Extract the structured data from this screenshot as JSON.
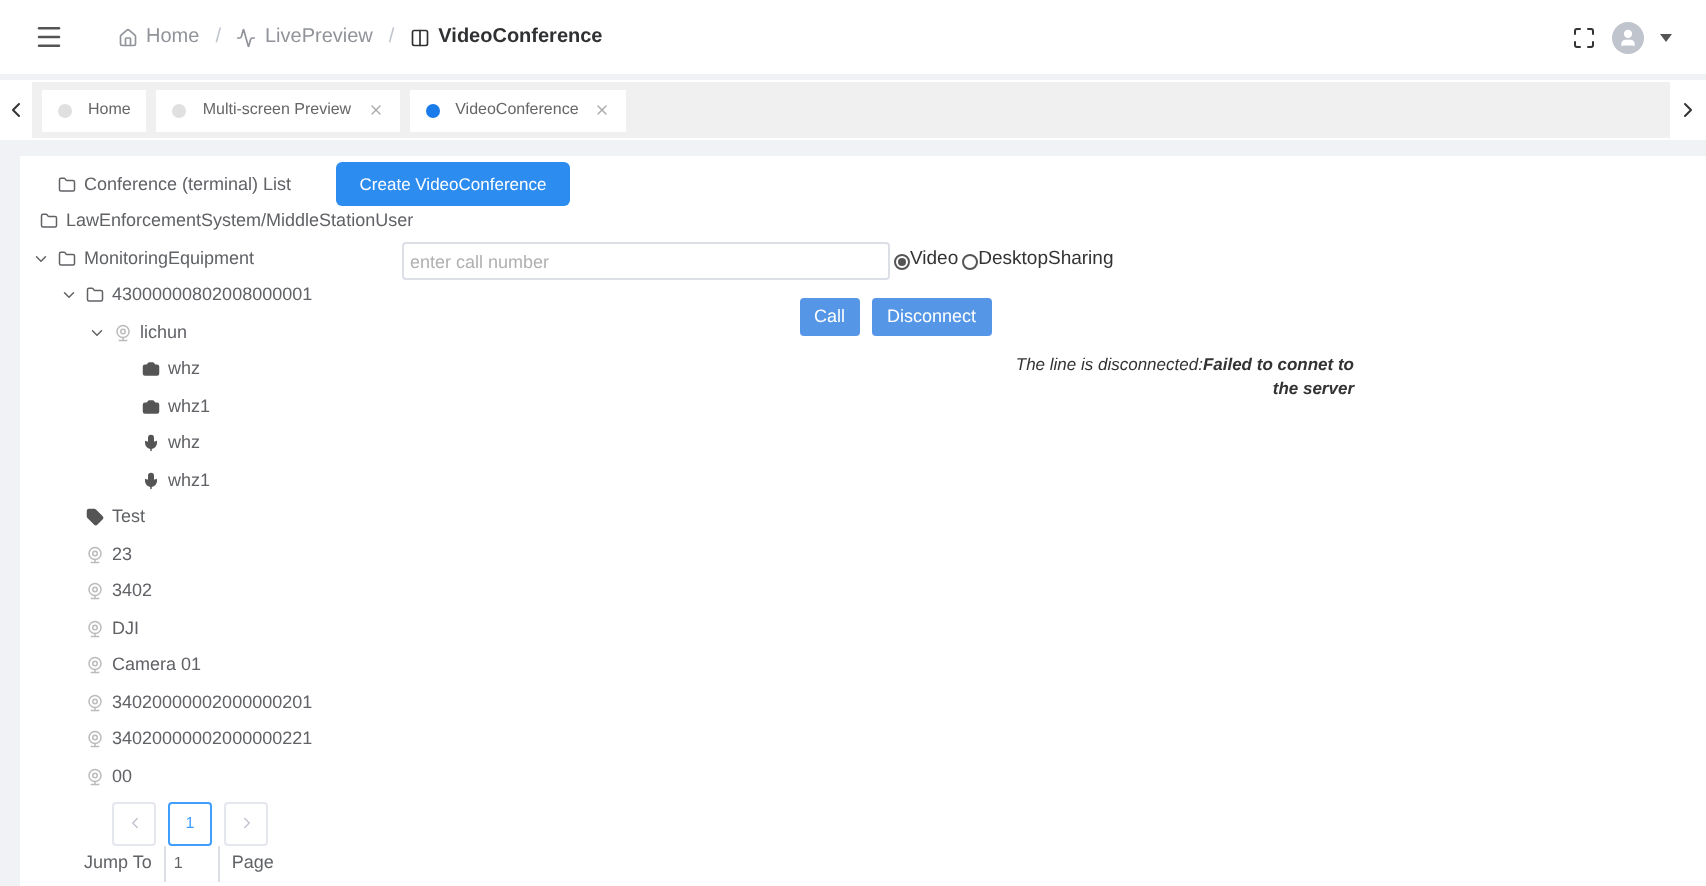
{
  "breadcrumb": [
    {
      "label": "Home",
      "kind": "home"
    },
    {
      "label": "LivePreview",
      "kind": "pulse"
    },
    {
      "label": "VideoConference",
      "kind": "screen"
    }
  ],
  "breadcrumb_separator": "/",
  "tabs": [
    {
      "label": "Home",
      "selected": false,
      "closable": false
    },
    {
      "label": "Multi-screen Preview",
      "selected": false,
      "closable": true
    },
    {
      "label": "VideoConference",
      "selected": true,
      "closable": true
    }
  ],
  "tree": [
    {
      "label": "Conference (terminal) List",
      "kind": "folder"
    },
    {
      "label": "LawEnforcementSystem/MiddleStationUser",
      "kind": "folder"
    },
    {
      "label": "MonitoringEquipment",
      "kind": "folder",
      "expanded": true,
      "children": [
        {
          "label": "43000000802008000001",
          "kind": "folder",
          "expanded": true,
          "children": [
            {
              "label": "lichun",
              "kind": "device",
              "expanded": true,
              "children": [
                {
                  "label": "whz",
                  "kind": "camera"
                },
                {
                  "label": "whz1",
                  "kind": "camera"
                },
                {
                  "label": "whz",
                  "kind": "mic"
                },
                {
                  "label": "whz1",
                  "kind": "mic"
                }
              ]
            }
          ]
        },
        {
          "label": "Test",
          "kind": "tag"
        },
        {
          "label": "23",
          "kind": "device"
        },
        {
          "label": "3402",
          "kind": "device"
        },
        {
          "label": "DJI",
          "kind": "device"
        },
        {
          "label": "Camera 01",
          "kind": "device"
        },
        {
          "label": "34020000002000000201",
          "kind": "device"
        },
        {
          "label": "34020000002000000221",
          "kind": "device"
        },
        {
          "label": "00",
          "kind": "device"
        }
      ]
    }
  ],
  "create_button": "Create VideoConference",
  "call_number": {
    "placeholder": "enter call number"
  },
  "modes": [
    {
      "label": "Video",
      "selected": true
    },
    {
      "label": "DesktopSharing",
      "selected": false
    }
  ],
  "call_button": "Call",
  "disconnect_button": "Disconnect",
  "status": "The line is disconnected:**Failed to connet to the server**",
  "pagination": {
    "pages": [
      {
        "label": "1",
        "selected": true
      }
    ],
    "jump_label": "Jump To",
    "jump_value": "1",
    "page_label": "Page"
  }
}
